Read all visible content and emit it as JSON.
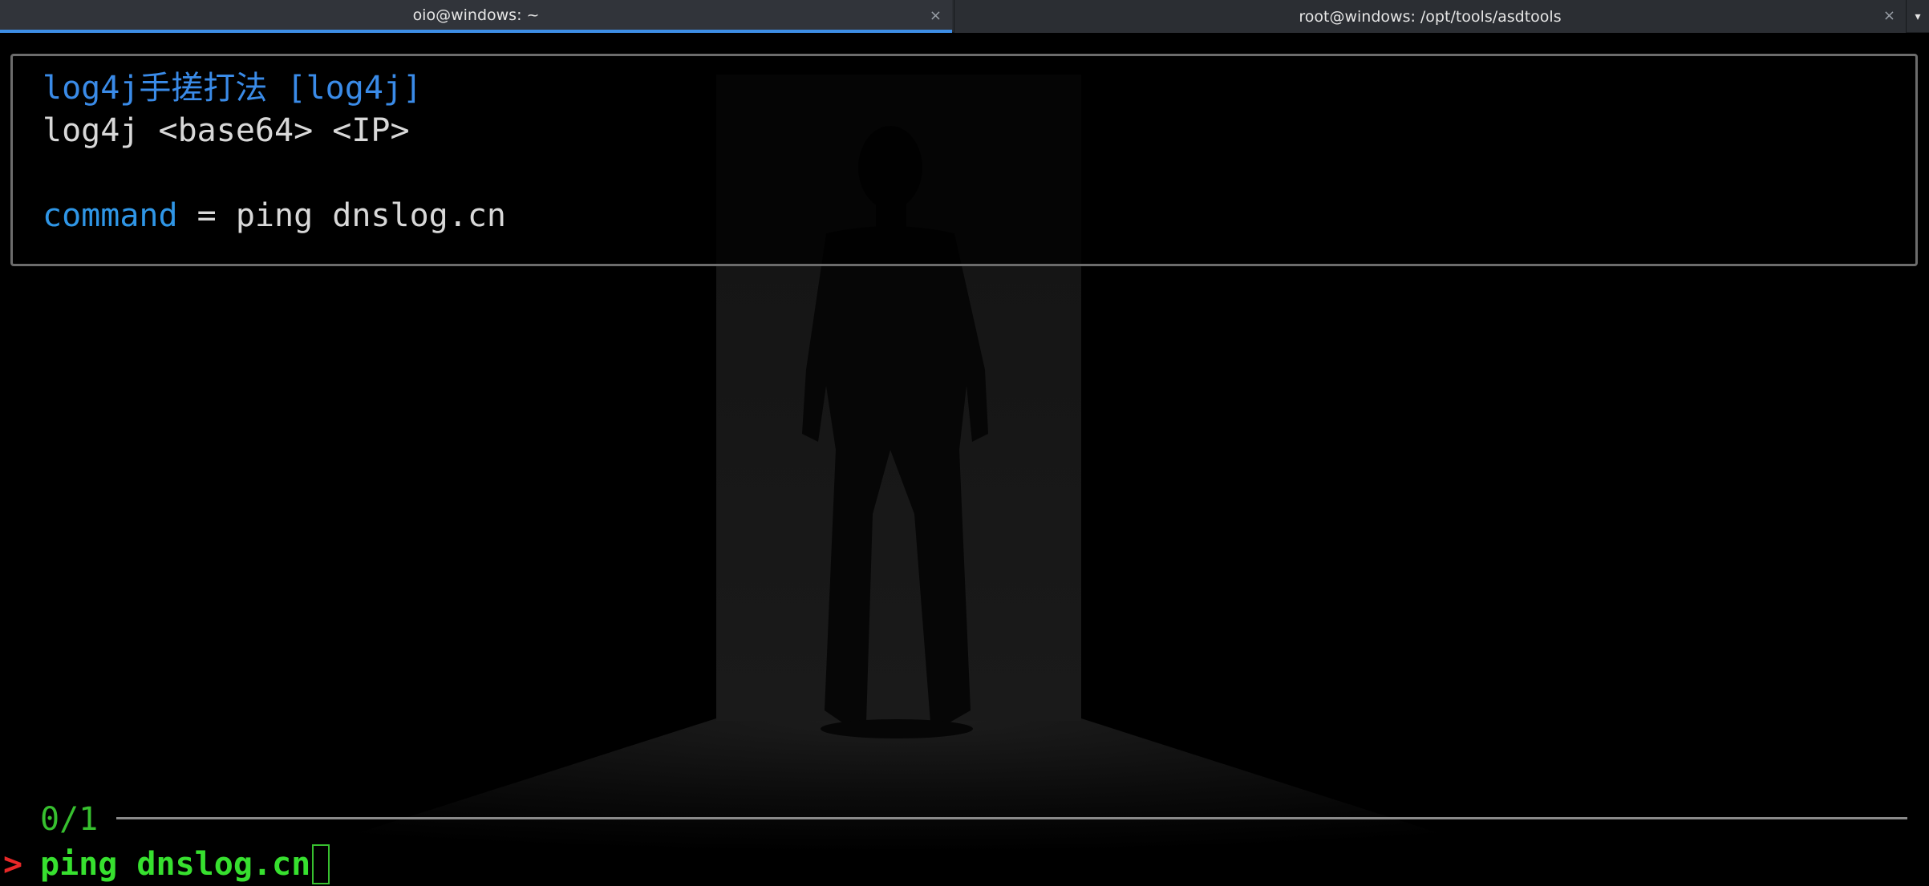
{
  "tabs": [
    {
      "title": "oio@windows: ~",
      "active": true,
      "close_glyph": "×"
    },
    {
      "title": "root@windows: /opt/tools/asdtools",
      "active": false,
      "close_glyph": "×"
    }
  ],
  "tab_menu_glyph": "▾",
  "preview": {
    "title": "log4j手搓打法 [log4j]",
    "syntax": "log4j <base64> <IP>",
    "command_key": "command",
    "command_eq": " = ",
    "command_value": "ping dnslog.cn"
  },
  "status": {
    "counter": "0/1"
  },
  "prompt": {
    "arrow": ">",
    "input": "ping dnslog.cn"
  },
  "colors": {
    "accent_tab": "#3d8ee6",
    "title_blue": "#3a8be8",
    "prompt_green": "#37e02f",
    "prompt_arrow_red": "#e82828"
  }
}
